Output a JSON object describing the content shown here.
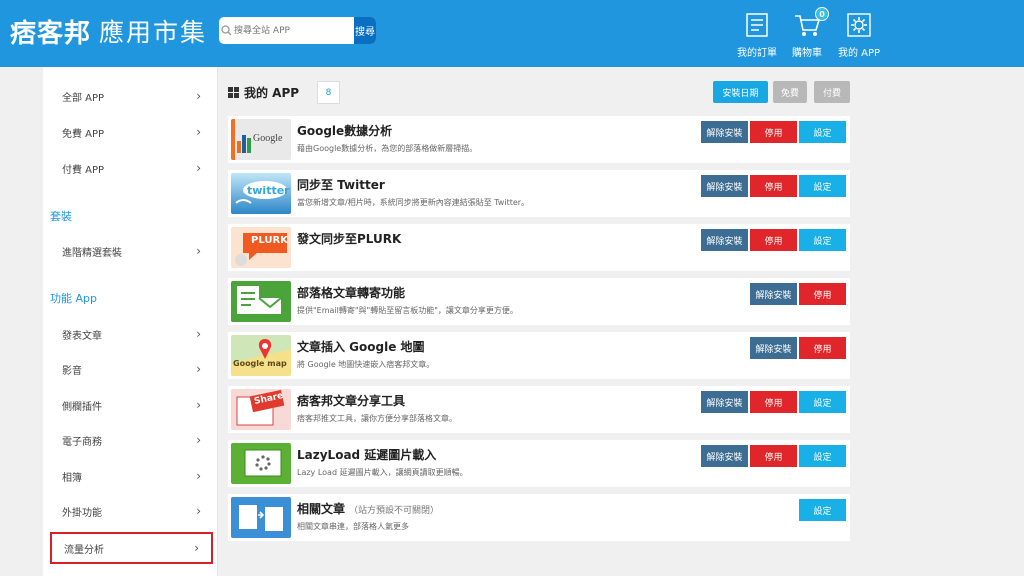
{
  "header": {
    "logo_main": "痞客邦",
    "logo_sub": "應用市集",
    "search": {
      "placeholder": "搜尋全站 APP",
      "button": "搜尋"
    },
    "nav": [
      {
        "label": "我的訂單",
        "icon": "order-list-icon"
      },
      {
        "label": "購物車",
        "icon": "cart-icon",
        "badge": "0"
      },
      {
        "label": "我的 APP",
        "icon": "my-app-gear-icon"
      }
    ],
    "color": "#1f96de"
  },
  "sidebar": {
    "top_items": [
      "全部 APP",
      "免費 APP",
      "付費 APP"
    ],
    "section_package": "套裝",
    "package_items": [
      "進階精選套裝"
    ],
    "section_feature": "功能 App",
    "feature_items": [
      "發表文章",
      "影音",
      "側欄插件",
      "電子商務",
      "相簿",
      "外掛功能",
      "流量分析"
    ]
  },
  "main": {
    "title": "我的 APP",
    "count": "8",
    "filters": [
      "安裝日期",
      "免費",
      "付費"
    ],
    "buttons": {
      "uninstall": "解除安裝",
      "disable": "停用",
      "settings": "設定"
    },
    "apps": [
      {
        "title": "Google數據分析",
        "note": "",
        "desc": "藉由Google數據分析，為您的部落格做新層掃描。",
        "actions": [
          "uninstall",
          "disable",
          "settings"
        ],
        "thumb": "google-analytics",
        "thumb_text": "Google"
      },
      {
        "title": "同步至 Twitter",
        "note": "",
        "desc": "當您新增文章/相片時，系統同步將更新內容連結張貼至 Twitter。",
        "actions": [
          "uninstall",
          "disable",
          "settings"
        ],
        "thumb": "twitter",
        "thumb_text": "twitter"
      },
      {
        "title": "發文同步至PLURK",
        "note": "",
        "desc": "",
        "actions": [
          "uninstall",
          "disable",
          "settings"
        ],
        "thumb": "plurk",
        "thumb_text": "PLURK"
      },
      {
        "title": "部落格文章轉寄功能",
        "note": "",
        "desc": "提供\"Email轉寄\"與\"轉貼至留言板功能\"，讓文章分享更方便。",
        "actions": [
          "uninstall",
          "disable"
        ],
        "thumb": "email-forward",
        "thumb_text": ""
      },
      {
        "title": "文章插入 Google 地圖",
        "note": "",
        "desc": "將 Google 地圖快速嵌入痞客邦文章。",
        "actions": [
          "uninstall",
          "disable"
        ],
        "thumb": "google-map",
        "thumb_text": "Google map"
      },
      {
        "title": "痞客邦文章分享工具",
        "note": "",
        "desc": "痞客邦推文工具，讓你方便分享部落格文章。",
        "actions": [
          "uninstall",
          "disable",
          "settings"
        ],
        "thumb": "share",
        "thumb_text": "Share"
      },
      {
        "title": "LazyLoad 延遲圖片載入",
        "note": "",
        "desc": "Lazy Load 延遲圖片載入，讓網頁讀取更順暢。",
        "actions": [
          "uninstall",
          "disable",
          "settings"
        ],
        "thumb": "lazyload",
        "thumb_text": ""
      },
      {
        "title": "相關文章",
        "note": "（站方預設不可關閉）",
        "desc": "相關文章串連，部落格人氣更多",
        "actions": [
          "settings"
        ],
        "thumb": "related",
        "thumb_text": ""
      }
    ]
  }
}
